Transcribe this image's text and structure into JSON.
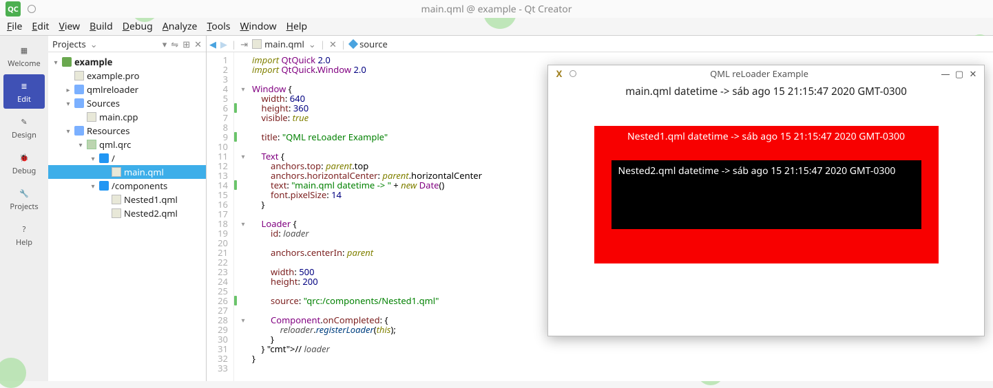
{
  "window_title": "main.qml @ example - Qt Creator",
  "menus": [
    "File",
    "Edit",
    "View",
    "Build",
    "Debug",
    "Analyze",
    "Tools",
    "Window",
    "Help"
  ],
  "leftbar": [
    {
      "label": "Welcome"
    },
    {
      "label": "Edit",
      "active": true
    },
    {
      "label": "Design"
    },
    {
      "label": "Debug"
    },
    {
      "label": "Projects"
    },
    {
      "label": "Help"
    }
  ],
  "sidebar": {
    "header": "Projects"
  },
  "tree": [
    {
      "d": 0,
      "tw": "▾",
      "icon": "proj",
      "label": "example",
      "bold": true
    },
    {
      "d": 1,
      "tw": "",
      "icon": "cpp",
      "label": "example.pro"
    },
    {
      "d": 1,
      "tw": "▸",
      "icon": "hdr",
      "label": "qmlreloader"
    },
    {
      "d": 1,
      "tw": "▾",
      "icon": "hdr",
      "label": "Sources"
    },
    {
      "d": 2,
      "tw": "",
      "icon": "cpp",
      "label": "main.cpp"
    },
    {
      "d": 1,
      "tw": "▾",
      "icon": "hdr",
      "label": "Resources"
    },
    {
      "d": 2,
      "tw": "▾",
      "icon": "qrc",
      "label": "qml.qrc"
    },
    {
      "d": 3,
      "tw": "▾",
      "icon": "folder",
      "label": "/"
    },
    {
      "d": 4,
      "tw": "",
      "icon": "qml",
      "label": "main.qml",
      "sel": true
    },
    {
      "d": 3,
      "tw": "▾",
      "icon": "folder",
      "label": "/components"
    },
    {
      "d": 4,
      "tw": "",
      "icon": "qml",
      "label": "Nested1.qml"
    },
    {
      "d": 4,
      "tw": "",
      "icon": "qml",
      "label": "Nested2.qml"
    }
  ],
  "editor": {
    "file": "main.qml",
    "path_hint": "source",
    "lines": [
      "import QtQuick 2.0",
      "import QtQuick.Window 2.0",
      "",
      "Window {",
      "    width: 640",
      "    height: 360",
      "    visible: true",
      "",
      "    title: \"QML reLoader Example\"",
      "",
      "    Text {",
      "        anchors.top: parent.top",
      "        anchors.horizontalCenter: parent.horizontalCenter",
      "        text: \"main.qml datetime -> \" + new Date()",
      "        font.pixelSize: 14",
      "    }",
      "",
      "    Loader {",
      "        id: loader",
      "",
      "        anchors.centerIn: parent",
      "",
      "        width: 500",
      "        height: 200",
      "",
      "        source: \"qrc:/components/Nested1.qml\"",
      "",
      "        Component.onCompleted: {",
      "            reloader.registerLoader(this);",
      "        }",
      "    } // loader",
      "}",
      ""
    ],
    "fold": {
      "4": "▾",
      "11": "▾",
      "18": "▾",
      "28": "▾"
    },
    "green_marks": [
      6,
      9,
      14,
      26
    ]
  },
  "dim_overlay": "1442 x 555",
  "floatwin": {
    "title": "QML reLoader Example",
    "main_text": "main.qml datetime -> sáb ago 15 21:15:47 2020 GMT-0300",
    "nested1": "Nested1.qml datetime -> sáb ago 15 21:15:47 2020 GMT-0300",
    "nested2": "Nested2.qml datetime -> sáb ago 15 21:15:47 2020 GMT-0300"
  }
}
